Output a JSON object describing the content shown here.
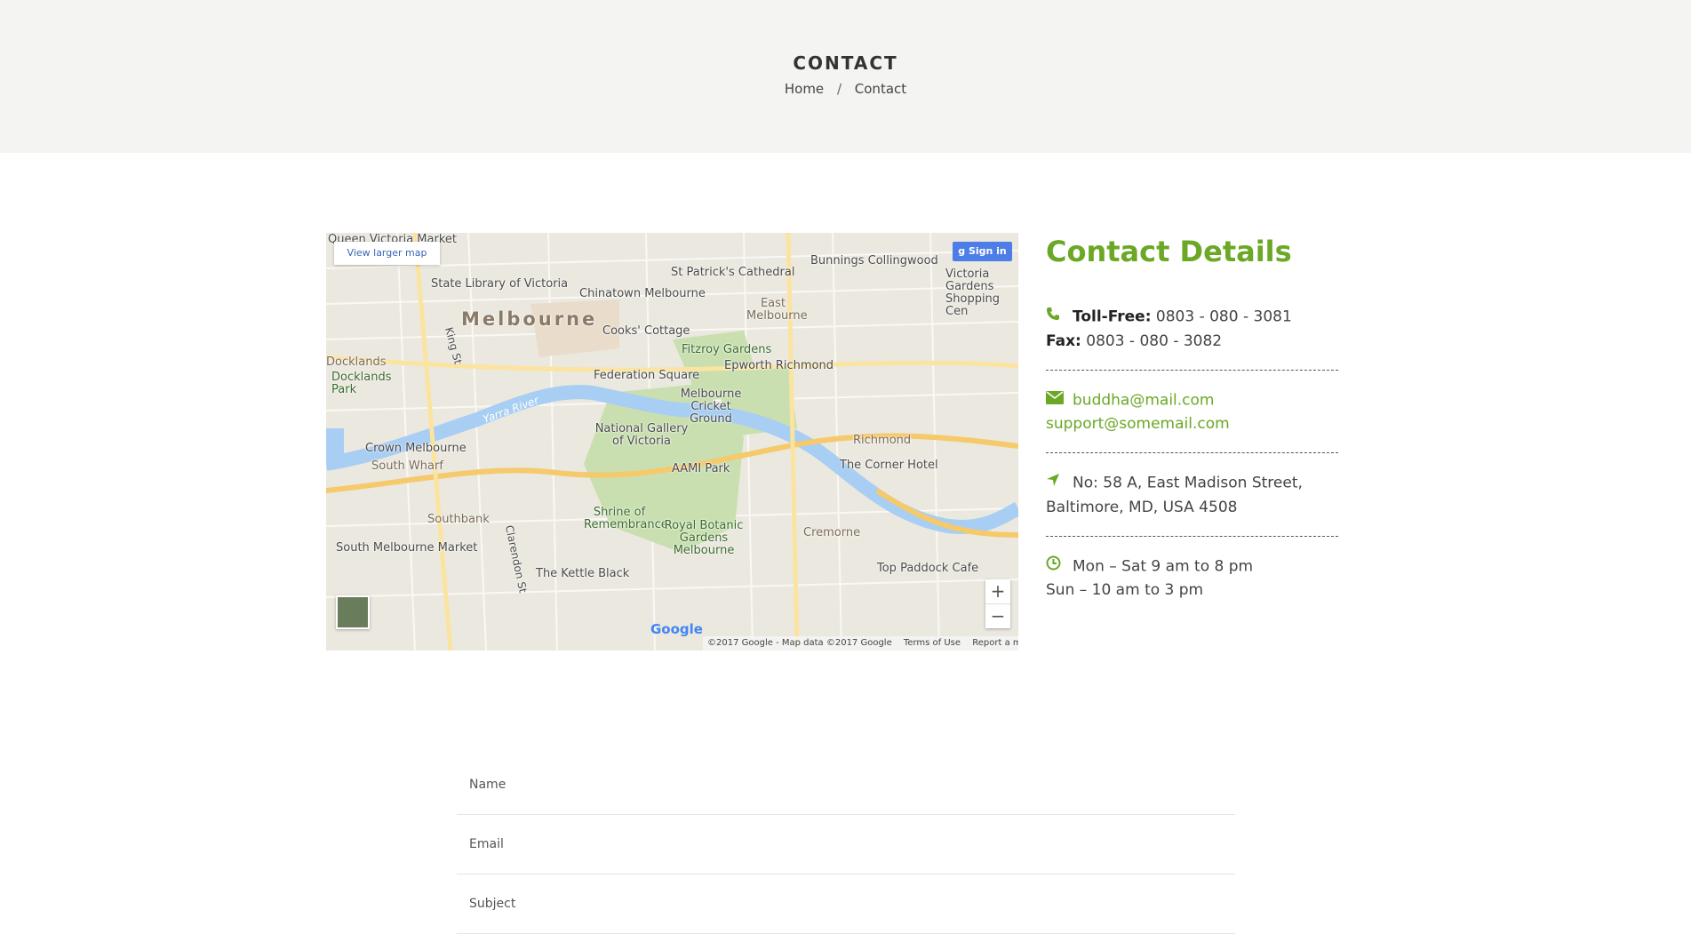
{
  "header": {
    "title": "CONTACT",
    "breadcrumb": {
      "home": "Home",
      "separator": "/",
      "current": "Contact"
    }
  },
  "map": {
    "view_larger": "View larger map",
    "sign_in": "Sign in",
    "zoom_in": "+",
    "zoom_out": "−",
    "google": "Google",
    "copyright": "©2017 Google - Map data ©2017 Google",
    "terms": "Terms of Use",
    "report": "Report a map error",
    "labels": {
      "melbourne": "Melbourne",
      "state_library": "State Library of Victoria",
      "chinatown": "Chinatown Melbourne",
      "cooks_cottage": "Cooks' Cottage",
      "st_patricks": "St Patrick's Cathedral",
      "east_melbourne": "East Melbourne",
      "fitzroy_gardens": "Fitzroy Gardens",
      "epworth": "Epworth Richmond",
      "federation_square": "Federation Square",
      "cricket_ground": "Melbourne Cricket Ground",
      "national_gallery": "National Gallery of Victoria",
      "aami_park": "AAMI Park",
      "richmond": "Richmond",
      "corner_hotel": "The Corner Hotel",
      "crown": "Crown Melbourne",
      "south_wharf": "South Wharf",
      "southbank": "Southbank",
      "shrine": "Shrine of Remembrance",
      "botanic": "Royal Botanic Gardens Melbourne",
      "cremorne": "Cremorne",
      "south_market": "South Melbourne Market",
      "kettle_black": "The Kettle Black",
      "top_paddock": "Top Paddock Cafe",
      "docklands": "Docklands",
      "docklands_park": "Docklands Park",
      "queen_victoria": "Queen Victoria Market",
      "bunnings": "Bunnings Collingwood",
      "victoria_gardens": "Victoria Gardens Shopping Cen",
      "yarra_river": "Yarra River",
      "king_st": "King St",
      "clarendon_st": "Clarendon St"
    }
  },
  "contact": {
    "title": "Contact Details",
    "toll_free_label": "Toll-Free:",
    "toll_free": "0803 - 080 - 3081",
    "fax_label": "Fax:",
    "fax": "0803 - 080 - 3082",
    "email1": "buddha@mail.com",
    "email2": "support@somemail.com",
    "address1": "No: 58 A, East Madison Street,",
    "address2": "Baltimore, MD, USA 4508",
    "hours1": "Mon – Sat 9 am to 8 pm",
    "hours2": "Sun – 10 am to 3 pm"
  },
  "form": {
    "name_placeholder": "Name",
    "email_placeholder": "Email",
    "subject_placeholder": "Subject"
  },
  "colors": {
    "accent": "#6aa825",
    "hero_bg": "#f4f4f3"
  }
}
